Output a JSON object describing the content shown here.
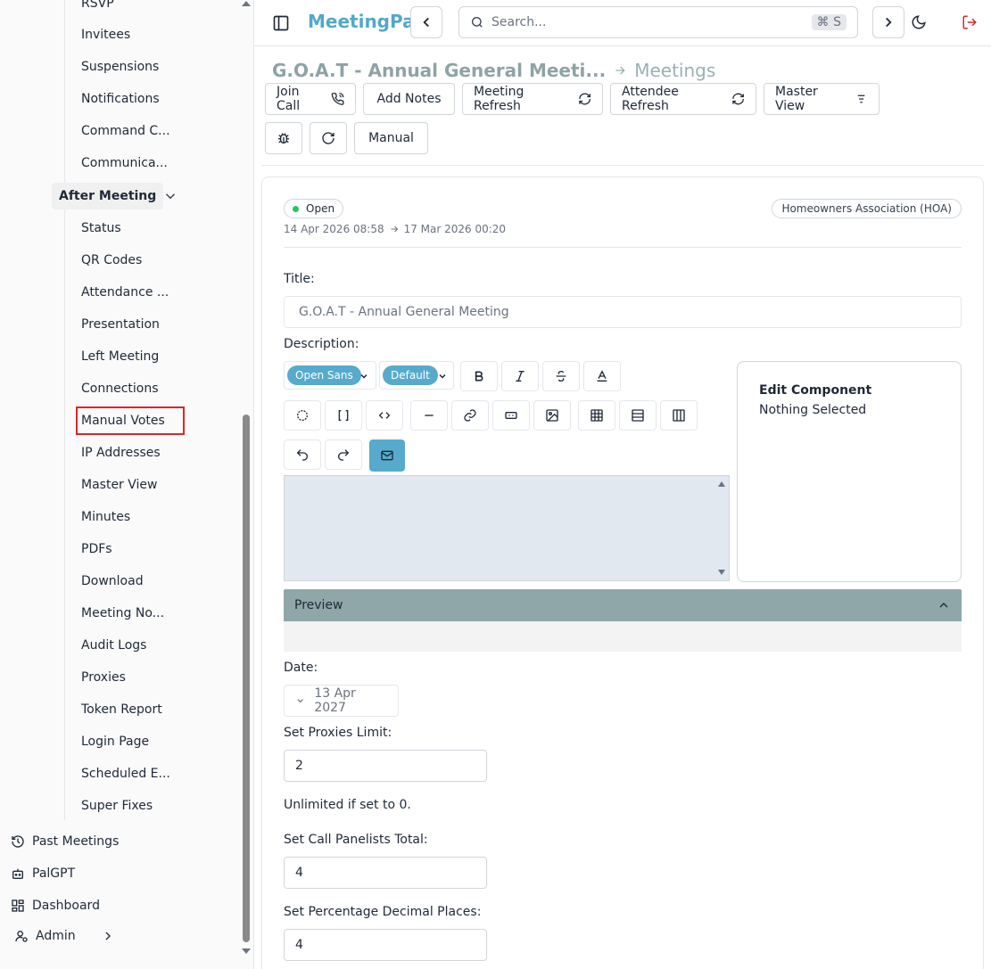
{
  "sidebar": {
    "items_top": [
      "RSVP",
      "Invitees",
      "Suspensions",
      "Notifications",
      "Command C...",
      "Communica..."
    ],
    "section_label": "After Meeting",
    "items_after": [
      "Status",
      "QR Codes",
      "Attendance ...",
      "Presentation",
      "Left Meeting",
      "Connections",
      "Manual Votes",
      "IP Addresses",
      "Master View",
      "Minutes",
      "PDFs",
      "Download",
      "Meeting No...",
      "Audit Logs",
      "Proxies",
      "Token Report",
      "Login Page",
      "Scheduled E...",
      "Super Fixes"
    ],
    "bottom": {
      "past_meetings": "Past Meetings",
      "palgpt": "PalGPT",
      "dashboard": "Dashboard",
      "admin": "Admin"
    }
  },
  "topbar": {
    "brand": "MeetingPal",
    "search_placeholder": "Search...",
    "shortcut": "⌘ S"
  },
  "breadcrumb": {
    "title": "G.O.A.T - Annual General Meeti...",
    "section": "Meetings"
  },
  "toolbar": {
    "join_call": "Join Call",
    "add_notes": "Add Notes",
    "meeting_refresh": "Meeting Refresh",
    "attendee_refresh": "Attendee Refresh",
    "master_view": "Master View",
    "manual": "Manual"
  },
  "meeting": {
    "status": "Open",
    "start": "14 Apr 2026 08:58",
    "end": "17 Mar 2026 00:20",
    "org_type": "Homeowners Association (HOA)",
    "title_label": "Title:",
    "title_value": "G.O.A.T - Annual General Meeting",
    "description_label": "Description:",
    "font_family": "Open Sans",
    "font_size": "Default",
    "edit_component_title": "Edit Component",
    "edit_component_text": "Nothing Selected",
    "preview_label": "Preview",
    "date_label": "Date:",
    "date_value": "13 Apr 2027",
    "proxies_label": "Set Proxies Limit:",
    "proxies_value": "2",
    "proxies_hint": "Unlimited if set to 0.",
    "panelists_label": "Set Call Panelists Total:",
    "panelists_value": "4",
    "decimals_label": "Set Percentage Decimal Places:",
    "decimals_value": "4"
  },
  "colors": {
    "brand": "#52a8c8",
    "accent": "#57aacb",
    "preview_bar": "#8fa7a9",
    "status_open": "#22c55e",
    "highlight": "#dc2626"
  }
}
